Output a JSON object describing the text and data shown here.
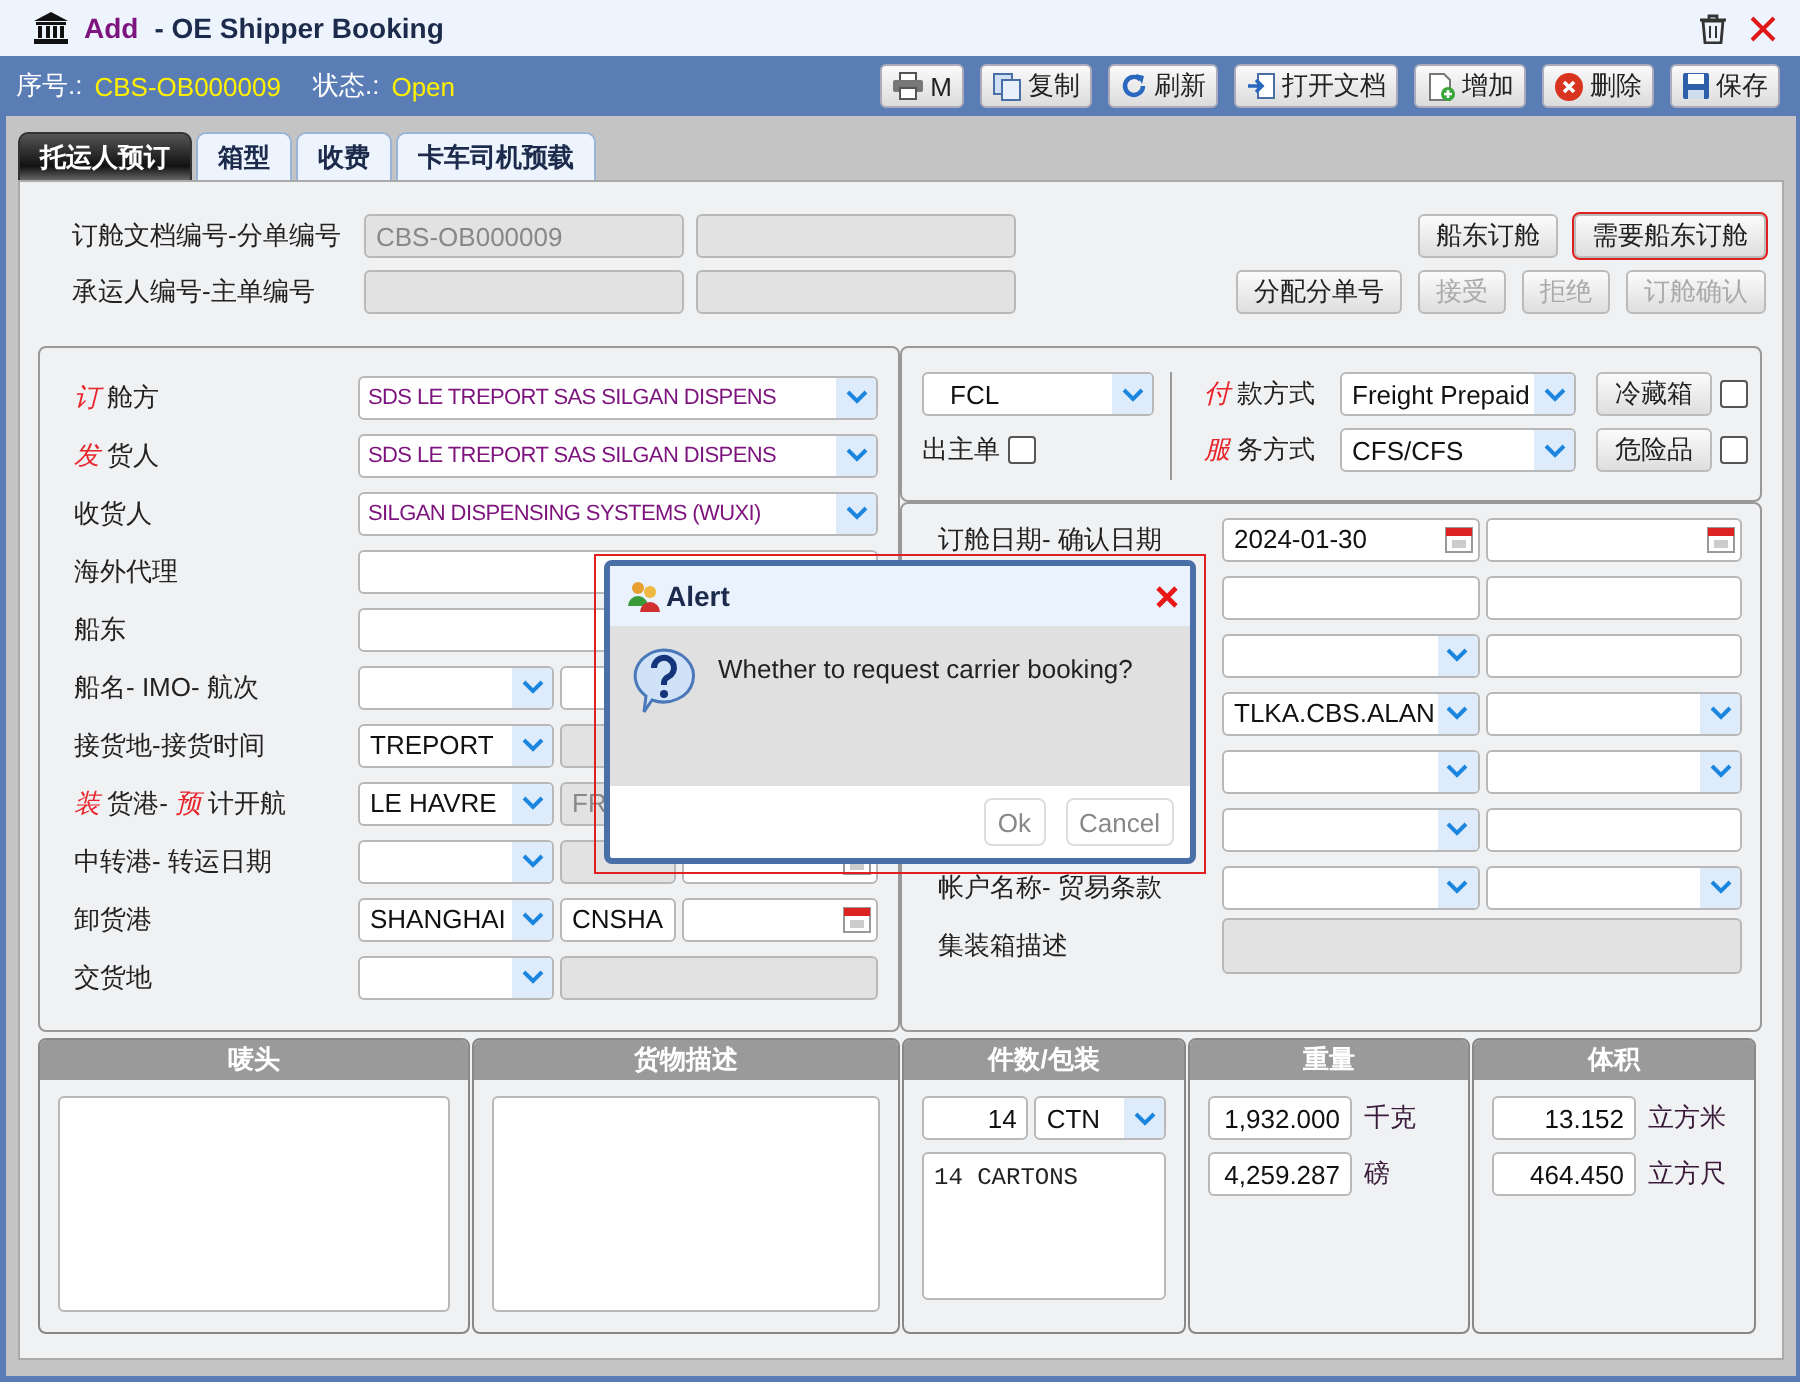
{
  "window": {
    "action": "Add",
    "title": "- OE Shipper Booking"
  },
  "toolbar": {
    "fields": [
      {
        "label": "序号.:",
        "value": "CBS-OB000009"
      },
      {
        "label": "状态.:",
        "value": "Open"
      }
    ],
    "buttons": [
      {
        "kind": "print",
        "label": "M"
      },
      {
        "kind": "copy",
        "label": "复制"
      },
      {
        "kind": "refresh",
        "label": "刷新"
      },
      {
        "kind": "open",
        "label": "打开文档"
      },
      {
        "kind": "add",
        "label": "增加"
      },
      {
        "kind": "delete",
        "label": "删除"
      },
      {
        "kind": "save",
        "label": "保存"
      }
    ]
  },
  "tabs": [
    {
      "label": "托运人预订",
      "selected": true
    },
    {
      "label": "箱型",
      "selected": false
    },
    {
      "label": "收费",
      "selected": false
    },
    {
      "label": "卡车司机预载",
      "selected": false
    }
  ],
  "document": {
    "rows": [
      {
        "label": "订舱文档编号-分单编号",
        "fields": [
          {
            "kind": "readonly",
            "value": "CBS-OB000009"
          },
          {
            "kind": "readonly"
          }
        ]
      },
      {
        "label": "承运人编号-主单编号",
        "fields": [
          {
            "kind": "readonly"
          },
          {
            "kind": "readonly"
          }
        ]
      }
    ]
  },
  "action_rows": [
    {
      "buttons": [
        {
          "label": "船东订舱",
          "disabled": false,
          "highlighted": false
        },
        {
          "label": "需要船东订舱",
          "disabled": false,
          "highlighted": true
        }
      ]
    },
    {
      "buttons": [
        {
          "label": "分配分单号",
          "disabled": false,
          "highlighted": false
        },
        {
          "label": "接受",
          "disabled": true,
          "highlighted": false
        },
        {
          "label": "拒绝",
          "disabled": true,
          "highlighted": false
        },
        {
          "label": "订舱确认",
          "disabled": true,
          "highlighted": false
        }
      ]
    }
  ],
  "parties": {
    "rows": [
      {
        "label": "*订* 舱方",
        "fields": [
          {
            "kind": "party",
            "value": "SDS LE TREPORT SAS SILGAN DISPENS"
          }
        ]
      },
      {
        "label": "*发* 货人",
        "fields": [
          {
            "kind": "party",
            "value": "SDS LE TREPORT SAS SILGAN DISPENS"
          }
        ]
      },
      {
        "label": "收货人",
        "fields": [
          {
            "kind": "party",
            "value": "SILGAN DISPENSING SYSTEMS (WUXI)"
          }
        ]
      },
      {
        "label": "海外代理",
        "fields": [
          {
            "kind": "text"
          }
        ]
      },
      {
        "label": "船东",
        "fields": [
          {
            "kind": "text"
          }
        ]
      },
      {
        "label": "船名- IMO- 航次",
        "fields": [
          {
            "kind": "select"
          },
          {
            "kind": "text"
          }
        ]
      },
      {
        "label": "接货地-接货时间",
        "fields": [
          {
            "kind": "select",
            "value": "TREPORT"
          },
          {
            "kind": "readonly"
          }
        ]
      },
      {
        "label": "*装* 货港- *预* 计开航",
        "fields": [
          {
            "kind": "select",
            "value": "LE HAVRE"
          },
          {
            "kind": "readonly",
            "value": "FR"
          }
        ]
      },
      {
        "label": "中转港- 转运日期",
        "fields": [
          {
            "kind": "select"
          },
          {
            "kind": "readonly"
          },
          {
            "kind": "date"
          }
        ]
      },
      {
        "label": "卸货港",
        "fields": [
          {
            "kind": "select",
            "value": "SHANGHAI"
          },
          {
            "kind": "text",
            "value": "CNSHA"
          },
          {
            "kind": "date"
          }
        ]
      },
      {
        "label": "交货地",
        "fields": [
          {
            "kind": "select"
          },
          {
            "kind": "readonly"
          }
        ]
      }
    ]
  },
  "shipment": {
    "type": "FCL",
    "master_bill": {
      "label": "出主单",
      "checked": false
    },
    "rows": [
      {
        "label": "*付* 款方式",
        "value": "Freight Prepaid",
        "button": "冷藏箱",
        "checked": false
      },
      {
        "label": "*服* 务方式",
        "value": "CFS/CFS",
        "button": "危险品",
        "checked": false
      }
    ]
  },
  "dates": {
    "rows": [
      {
        "label": "订舱日期- 确认日期",
        "fields": [
          {
            "kind": "date",
            "value": "2024-01-30"
          },
          {
            "kind": "date"
          }
        ]
      },
      {
        "fields": [
          {
            "kind": "text"
          },
          {
            "kind": "text"
          }
        ]
      },
      {
        "fields": [
          {
            "kind": "select"
          },
          {
            "kind": "text"
          }
        ]
      },
      {
        "fields": [
          {
            "kind": "select",
            "value": "TLKA.CBS.ALAN"
          },
          {
            "kind": "select"
          }
        ]
      },
      {
        "fields": [
          {
            "kind": "select"
          },
          {
            "kind": "select"
          }
        ]
      },
      {
        "fields": [
          {
            "kind": "select"
          },
          {
            "kind": "text"
          }
        ]
      },
      {
        "label": "帐户名称- 贸易条款",
        "fields": [
          {
            "kind": "select"
          },
          {
            "kind": "select"
          }
        ]
      },
      {
        "label": "集装箱描述",
        "fields": [
          {
            "kind": "readonly"
          }
        ]
      }
    ]
  },
  "cargo": [
    {
      "title": "唛头",
      "kind": "textarea"
    },
    {
      "title": "货物描述",
      "kind": "textarea"
    },
    {
      "title": "件数/包装",
      "kind": "packages",
      "count": "14",
      "unit": "CTN",
      "text": "14 CARTONS"
    },
    {
      "title": "重量",
      "kind": "measures",
      "rows": [
        {
          "value": "1,932.000",
          "unit": "千克"
        },
        {
          "value": "4,259.287",
          "unit": "磅"
        }
      ]
    },
    {
      "title": "体积",
      "kind": "measures",
      "rows": [
        {
          "value": "13.152",
          "unit": "立方米"
        },
        {
          "value": "464.450",
          "unit": "立方尺"
        }
      ]
    }
  ],
  "dialog": {
    "title": "Alert",
    "message": "Whether to request carrier booking?",
    "buttons": [
      "Ok",
      "Cancel"
    ],
    "highlighted": true
  }
}
